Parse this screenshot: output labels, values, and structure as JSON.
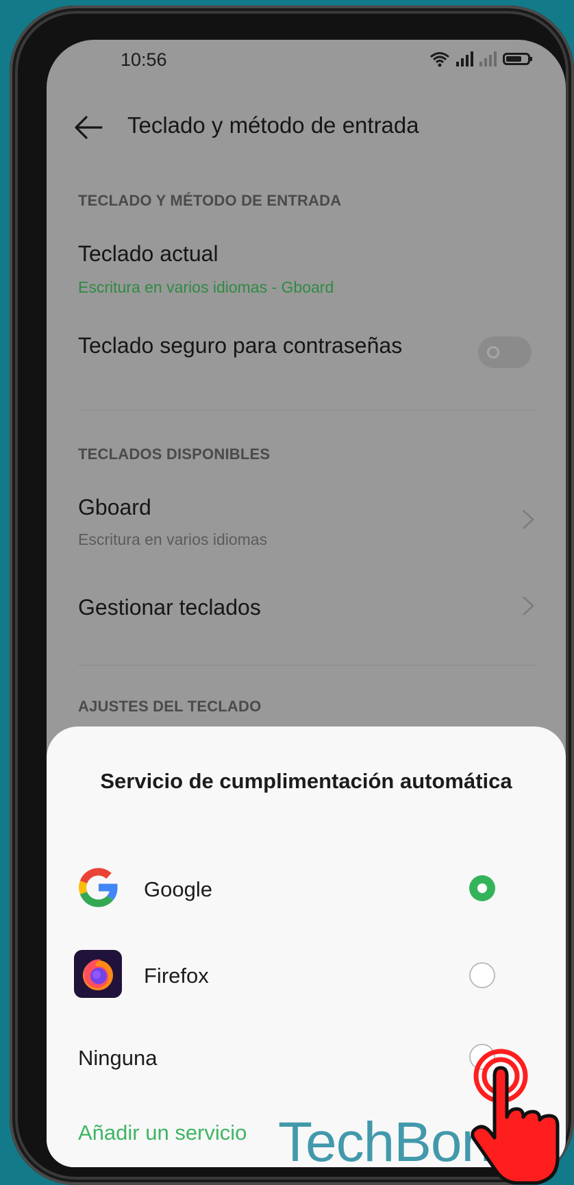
{
  "status_bar": {
    "time": "10:56"
  },
  "header": {
    "title": "Teclado y método de entrada"
  },
  "sections": {
    "input_method": {
      "label": "TECLADO Y MÉTODO DE ENTRADA",
      "current_keyboard": {
        "title": "Teclado actual",
        "value": "Escritura en varios idiomas - Gboard"
      },
      "secure_keyboard": {
        "title": "Teclado seguro para contraseñas",
        "enabled": false
      }
    },
    "available": {
      "label": "TECLADOS DISPONIBLES",
      "gboard": {
        "title": "Gboard",
        "subtitle": "Escritura en varios idiomas"
      },
      "manage": {
        "title": "Gestionar teclados"
      }
    },
    "settings": {
      "label": "AJUSTES DEL TECLADO"
    }
  },
  "sheet": {
    "title": "Servicio de cumplimentación automática",
    "options": [
      {
        "label": "Google",
        "icon": "google-icon",
        "selected": true
      },
      {
        "label": "Firefox",
        "icon": "firefox-icon",
        "selected": false
      },
      {
        "label": "Ninguna",
        "selected": false
      }
    ],
    "add_service": "Añadir un servicio"
  },
  "watermark": "TechBone",
  "colors": {
    "accent_green": "#35b35a",
    "link_green": "#3fb563",
    "background": "#137a8a"
  }
}
